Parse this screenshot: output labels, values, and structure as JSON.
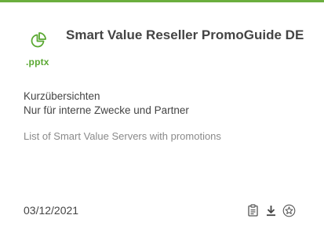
{
  "card": {
    "accent_color": "#6bae3e",
    "file_icon": "pie-chart-icon",
    "file_extension": ".pptx",
    "title": "Smart Value Reseller PromoGuide DE",
    "category_line1": "Kurzübersichten",
    "category_line2": "Nur für interne Zwecke und Partner",
    "description": "List of Smart Value Servers with promotions",
    "date": "03/12/2021",
    "actions": [
      "clipboard-icon",
      "download-icon",
      "favorite-star-icon"
    ]
  }
}
